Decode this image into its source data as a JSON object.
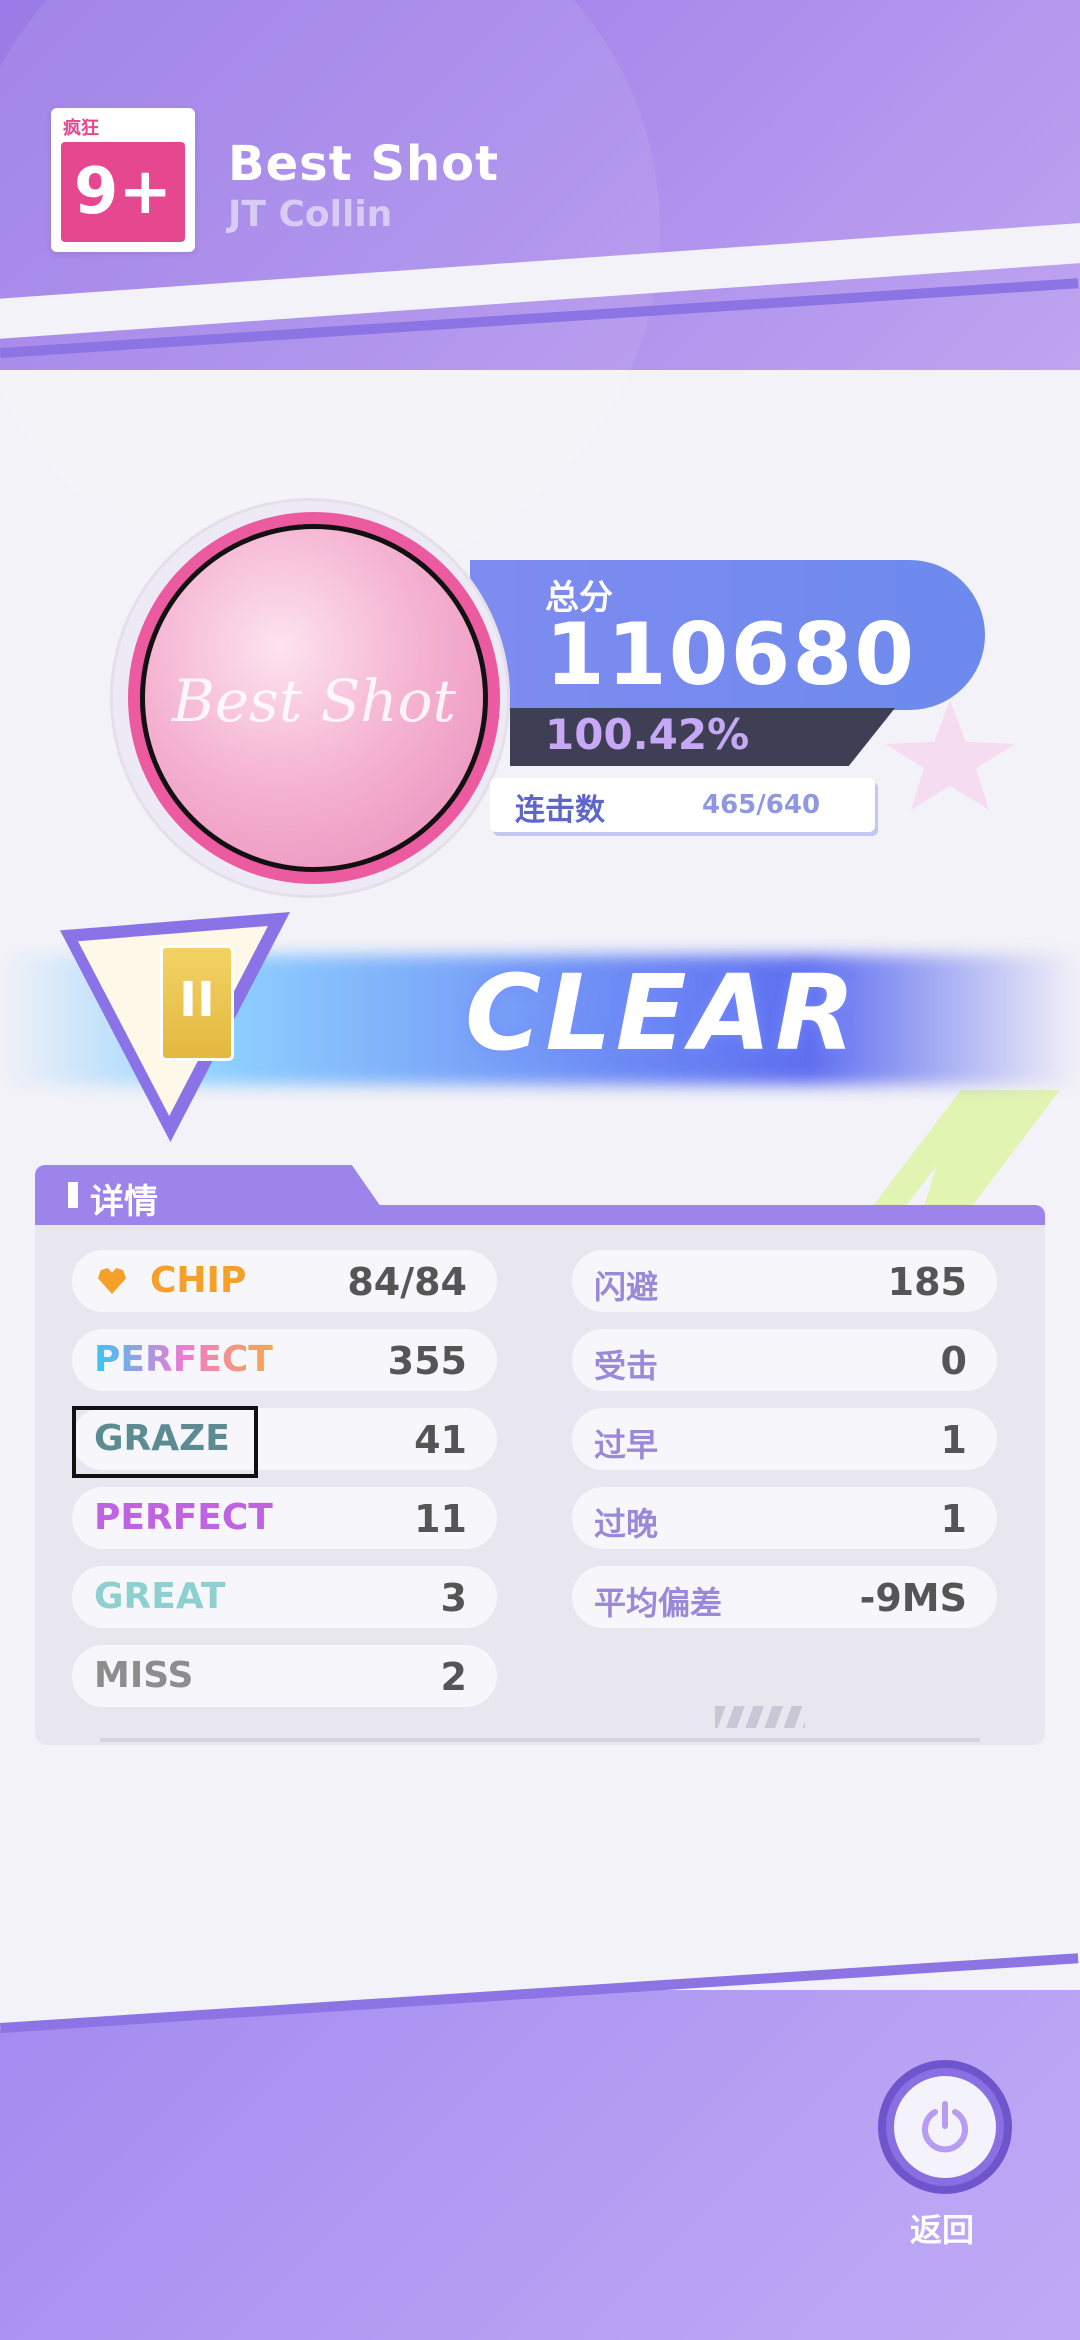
{
  "song": {
    "difficulty_label": "疯狂",
    "level": "9+",
    "title": "Best Shot",
    "artist": "JT Collin",
    "cover_text": "Best Shot"
  },
  "score": {
    "label": "总分",
    "value": "110680",
    "accuracy": "100.42%",
    "combo_label": "连击数",
    "combo_value": "465/640"
  },
  "result": {
    "status": "CLEAR",
    "rank_letter": "II"
  },
  "details": {
    "tab_label": "详情",
    "left": [
      {
        "label": "CHIP",
        "value": "84/84"
      },
      {
        "label": "PERFECT",
        "value": "355"
      },
      {
        "label": "GRAZE",
        "value": "41"
      },
      {
        "label": "PERFECT",
        "value": "11"
      },
      {
        "label": "GREAT",
        "value": "3"
      },
      {
        "label": "MISS",
        "value": "2"
      }
    ],
    "right": [
      {
        "label": "闪避",
        "value": "185"
      },
      {
        "label": "受击",
        "value": "0"
      },
      {
        "label": "过早",
        "value": "1"
      },
      {
        "label": "过晚",
        "value": "1"
      },
      {
        "label": "平均偏差",
        "value": "-9MS"
      }
    ]
  },
  "back_button": {
    "label": "返回",
    "icon": "power-icon"
  },
  "colors": {
    "accent_purple": "#9c84ea",
    "score_blue": "#6c8aee",
    "level_pink": "#e6488f"
  }
}
